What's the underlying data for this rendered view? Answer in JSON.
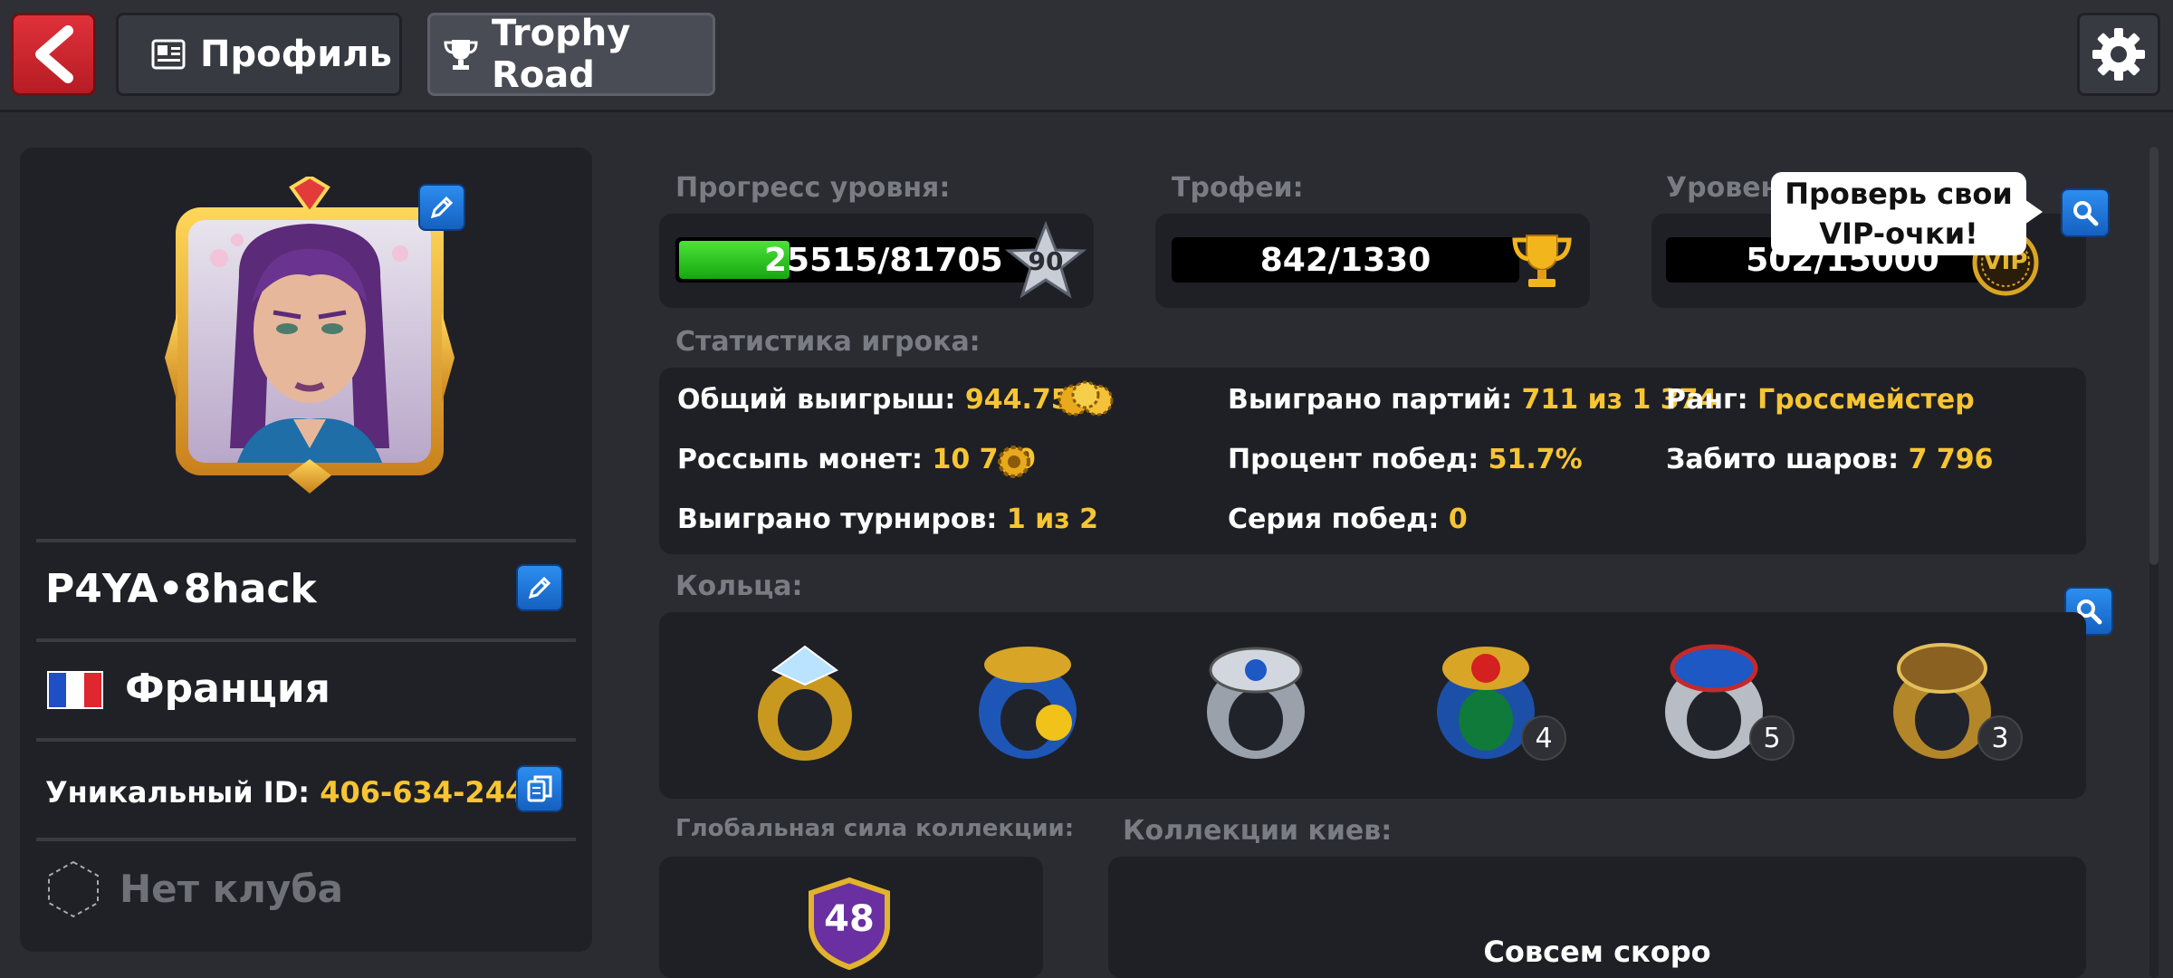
{
  "topbar": {
    "tabs": [
      {
        "label": "Профиль",
        "icon": "profile-card-icon",
        "active": false
      },
      {
        "label": "Trophy Road",
        "icon": "trophy-icon",
        "active": true
      }
    ]
  },
  "profile": {
    "username": "P4YA•8hack",
    "country": "Франция",
    "unique_id_label": "Уникальный ID:",
    "unique_id": "406-634-244-5",
    "club": "Нет клуба"
  },
  "progress": {
    "level_label": "Прогресс уровня:",
    "level_value": "25515/81705",
    "level_fraction": 0.312,
    "level_badge": "90",
    "trophies_label": "Трофеи:",
    "trophies_value": "842/1330",
    "vip_label": "Уровен",
    "vip_value": "502/15000",
    "vip_badge": "VIP"
  },
  "tooltip": {
    "line1": "Проверь свои",
    "line2": "VIP-очки!"
  },
  "stats": {
    "label": "Статистика игрока:",
    "total_win_label": "Общий выигрыш:",
    "total_win": "944.75M",
    "coin_scatter_label": "Россыпь монет:",
    "coin_scatter": "10 749",
    "tournaments_label": "Выиграно турниров:",
    "tournaments": "1 из 2",
    "games_won_label": "Выиграно партий:",
    "games_won": "711 из 1 374",
    "win_pct_label": "Процент побед:",
    "win_pct": "51.7%",
    "streak_label": "Серия побед:",
    "streak": "0",
    "rank_label": "Ранг:",
    "rank": "Гроссмейстер",
    "balls_label": "Забито шаров:",
    "balls": "7 796"
  },
  "rings": {
    "label": "Кольца:",
    "items": [
      {
        "name": "heist-ring-icon",
        "count": ""
      },
      {
        "name": "streak-ring-icon",
        "count": ""
      },
      {
        "name": "master-moscow-ring-icon",
        "count": ""
      },
      {
        "name": "champion-red-ring-icon",
        "count": "4"
      },
      {
        "name": "toronto-ring-icon",
        "count": "5"
      },
      {
        "name": "champion-gold-ring-icon",
        "count": "3"
      }
    ]
  },
  "collection": {
    "power_label": "Глобальная сила коллекции:",
    "power_value": "48",
    "cues_label": "Коллекции киев:",
    "cues_status": "Совсем скоро"
  },
  "colors": {
    "accent_yellow": "#f7c533",
    "progress_green": "#22c51b",
    "button_blue": "#1f78dc",
    "back_red": "#d4252d"
  }
}
